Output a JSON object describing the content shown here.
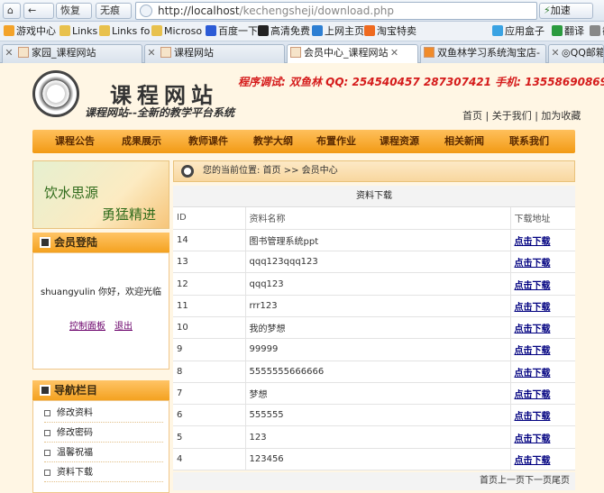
{
  "browser": {
    "home_label": "",
    "back_label": "恢复",
    "trace_label": "无痕",
    "url_host": "http://localhost",
    "url_path": "/kechengsheji/download.php",
    "speed_label": "加速",
    "favorites": [
      "游戏中心",
      "Links",
      "Links fo",
      "Microso",
      "百度一下",
      "高清免费",
      "上网主页",
      "淘宝特卖",
      "应用盒子",
      "翻译",
      "截"
    ],
    "tabs": [
      "家园_课程网站",
      "课程网站",
      "会员中心_课程网站",
      "双鱼林学习系统淘宝店-",
      "QQ邮箱"
    ]
  },
  "header": {
    "title": "课程网站",
    "subtitle": "课程网站--全新的教学平台系统",
    "contact": "程序调试: 双鱼林  QQ: 254540457  287307421   手机: 13558690869",
    "toplinks": [
      "首页",
      "关于我们",
      "加为收藏"
    ]
  },
  "menu": [
    "课程公告",
    "成果展示",
    "教师课件",
    "教学大纲",
    "布置作业",
    "课程资源",
    "相关新闻",
    "联系我们"
  ],
  "sidebar": {
    "banner_line1": "饮水思源",
    "banner_line2": "勇猛精进",
    "login_title": "会员登陆",
    "welcome": "shuangyulin 你好，欢迎光临",
    "control_panel": "控制面板",
    "logout": "退出",
    "nav_title": "导航栏目",
    "nav_items": [
      "修改资料",
      "修改密码",
      "温馨祝福",
      "资料下载"
    ]
  },
  "main": {
    "breadcrumb": "您的当前位置: 首页 >> 会员中心",
    "table_title": "资料下载",
    "columns": [
      "ID",
      "资料名称",
      "下载地址"
    ],
    "link_label": "点击下载",
    "rows": [
      {
        "id": "14",
        "name": "图书管理系统ppt"
      },
      {
        "id": "13",
        "name": "qqq123qqq123"
      },
      {
        "id": "12",
        "name": "qqq123"
      },
      {
        "id": "11",
        "name": "rrr123"
      },
      {
        "id": "10",
        "name": "我的梦想"
      },
      {
        "id": "9",
        "name": "99999"
      },
      {
        "id": "8",
        "name": "5555555666666"
      },
      {
        "id": "7",
        "name": "梦想"
      },
      {
        "id": "6",
        "name": "555555"
      },
      {
        "id": "5",
        "name": "123"
      },
      {
        "id": "4",
        "name": "123456"
      }
    ],
    "pager": "首页上一页下一页尾页"
  }
}
